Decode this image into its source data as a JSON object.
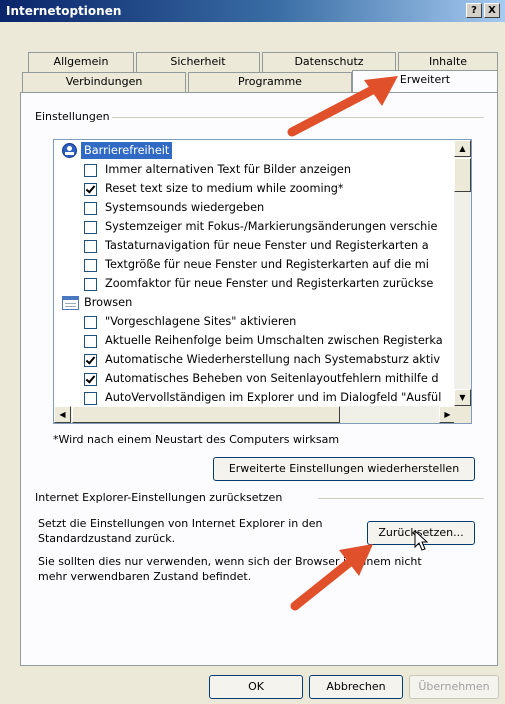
{
  "window": {
    "title": "Internetoptionen",
    "help_label": "?",
    "close_label": "X"
  },
  "tabs": {
    "row1": [
      "Allgemein",
      "Sicherheit",
      "Datenschutz",
      "Inhalte"
    ],
    "row2": [
      "Verbindungen",
      "Programme",
      "Erweitert"
    ],
    "active": "Erweitert"
  },
  "settings": {
    "group_label": "Einstellungen",
    "items": [
      {
        "type": "category",
        "label": "Barrierefreiheit",
        "selected": true
      },
      {
        "type": "checkbox",
        "label": "Immer alternativen Text für Bilder anzeigen",
        "checked": false
      },
      {
        "type": "checkbox",
        "label": "Reset text size to medium while zooming*",
        "checked": true
      },
      {
        "type": "checkbox",
        "label": "Systemsounds wiedergeben",
        "checked": false
      },
      {
        "type": "checkbox",
        "label": "Systemzeiger mit Fokus-/Markierungsänderungen verschie",
        "checked": false
      },
      {
        "type": "checkbox",
        "label": "Tastaturnavigation für neue Fenster und Registerkarten a",
        "checked": false
      },
      {
        "type": "checkbox",
        "label": "Textgröße für neue Fenster und Registerkarten auf die mi",
        "checked": false
      },
      {
        "type": "checkbox",
        "label": "Zoomfaktor für neue Fenster und Registerkarten zurückse",
        "checked": false
      },
      {
        "type": "category",
        "label": "Browsen",
        "selected": false
      },
      {
        "type": "checkbox",
        "label": "\"Vorgeschlagene Sites\" aktivieren",
        "checked": false
      },
      {
        "type": "checkbox",
        "label": "Aktuelle Reihenfolge beim Umschalten zwischen Registerka",
        "checked": false
      },
      {
        "type": "checkbox",
        "label": "Automatische Wiederherstellung nach Systemabsturz aktiv",
        "checked": true
      },
      {
        "type": "checkbox",
        "label": "Automatisches Beheben von Seitenlayoutfehlern mithilfe d",
        "checked": true
      },
      {
        "type": "checkbox",
        "label": "AutoVervollständigen im Explorer und im Dialogfeld \"Ausfül",
        "checked": false
      }
    ],
    "restart_note": "*Wird nach einem Neustart des Computers wirksam",
    "restore_button": "Erweiterte Einstellungen wiederherstellen"
  },
  "reset": {
    "group_label": "Internet Explorer-Einstellungen zurücksetzen",
    "description_line1": "Setzt die Einstellungen von Internet Explorer in den",
    "description_line2": "Standardzustand zurück.",
    "reset_button": "Zurücksetzen...",
    "warning_line1": "Sie sollten dies nur verwenden, wenn sich der Browser in einem nicht",
    "warning_line2": "mehr verwendbaren Zustand befindet."
  },
  "footer": {
    "ok": "OK",
    "cancel": "Abbrechen",
    "apply": "Übernehmen"
  },
  "colors": {
    "titlebar": "#0a246a",
    "selection": "#316ac5",
    "annotation_arrow": "#e0502a"
  }
}
